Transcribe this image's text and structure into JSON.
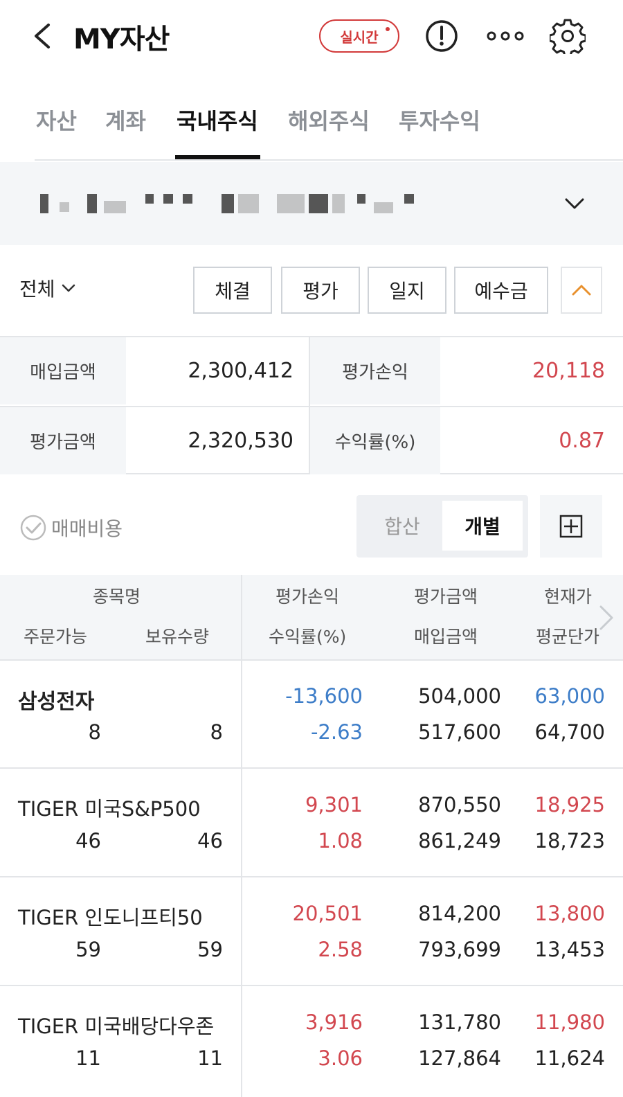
{
  "header": {
    "title": "MY자산",
    "realtime_badge": "실시간",
    "icons": [
      "back-icon",
      "info-icon",
      "more-icon",
      "gear-icon"
    ]
  },
  "tabs": [
    {
      "label": "자산",
      "active": false
    },
    {
      "label": "계좌",
      "active": false
    },
    {
      "label": "국내주식",
      "active": true
    },
    {
      "label": "해외주식",
      "active": false
    },
    {
      "label": "투자수익",
      "active": false
    }
  ],
  "filter": {
    "scope": "전체",
    "buttons": [
      "체결",
      "평가",
      "일지",
      "예수금"
    ]
  },
  "summary": {
    "purchase_label": "매입금액",
    "purchase_value": "2,300,412",
    "pl_label": "평가손익",
    "pl_value": "20,118",
    "eval_label": "평가금액",
    "eval_value": "2,320,530",
    "rate_label": "수익률(%)",
    "rate_value": "0.87"
  },
  "options": {
    "fee_label": "매매비용",
    "toggle_combined": "합산",
    "toggle_individual": "개별"
  },
  "table_header": {
    "name": "종목명",
    "orderable": "주문가능",
    "holding": "보유수량",
    "pl": "평가손익",
    "rate": "수익률(%)",
    "eval": "평가금액",
    "purchase": "매입금액",
    "current": "현재가",
    "avg": "평균단가"
  },
  "holdings": [
    {
      "name": "삼성전자",
      "orderable": "8",
      "holding": "8",
      "pl": "-13,600",
      "rate": "-2.63",
      "eval": "504,000",
      "purchase": "517,600",
      "current": "63,000",
      "avg": "64,700"
    },
    {
      "name": "TIGER 미국S&P500",
      "orderable": "46",
      "holding": "46",
      "pl": "9,301",
      "rate": "1.08",
      "eval": "870,550",
      "purchase": "861,249",
      "current": "18,925",
      "avg": "18,723"
    },
    {
      "name": "TIGER 인도니프티50",
      "orderable": "59",
      "holding": "59",
      "pl": "20,501",
      "rate": "2.58",
      "eval": "814,200",
      "purchase": "793,699",
      "current": "13,800",
      "avg": "13,453"
    },
    {
      "name": "TIGER 미국배당다우존",
      "orderable": "11",
      "holding": "11",
      "pl": "3,916",
      "rate": "3.06",
      "eval": "131,780",
      "purchase": "127,864",
      "current": "11,980",
      "avg": "11,624"
    }
  ],
  "colors": {
    "gain": "#d2474f",
    "loss": "#3d7dc8",
    "accent_orange": "#e8912f"
  }
}
